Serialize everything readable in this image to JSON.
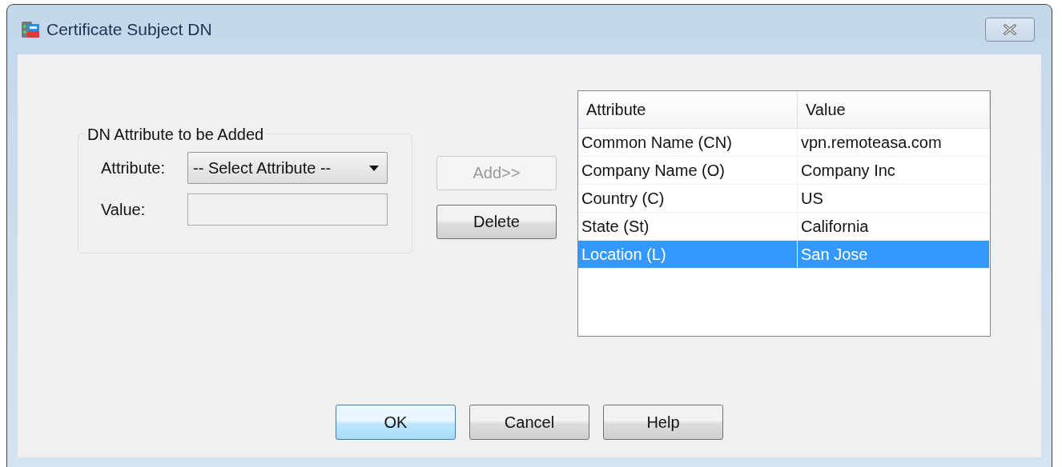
{
  "window": {
    "title": "Certificate Subject DN"
  },
  "group": {
    "title": "DN Attribute to be Added",
    "attribute_label": "Attribute:",
    "attribute_value": "-- Select Attribute --",
    "value_label": "Value:"
  },
  "side_buttons": [
    {
      "label": "Add>>",
      "disabled": true
    },
    {
      "label": "Delete",
      "disabled": false
    }
  ],
  "table": {
    "columns": [
      "Attribute",
      "Value"
    ],
    "rows": [
      {
        "cells": [
          "Common Name (CN)",
          "vpn.remoteasa.com"
        ],
        "selected": false
      },
      {
        "cells": [
          "Company Name (O)",
          "Company Inc"
        ],
        "selected": false
      },
      {
        "cells": [
          "Country (C)",
          "US"
        ],
        "selected": false
      },
      {
        "cells": [
          "State (St)",
          "California"
        ],
        "selected": false
      },
      {
        "cells": [
          "Location (L)",
          "San Jose"
        ],
        "selected": true
      }
    ]
  },
  "buttons": [
    {
      "label": "OK",
      "default": true
    },
    {
      "label": "Cancel",
      "default": false
    },
    {
      "label": "Help",
      "default": false
    }
  ]
}
